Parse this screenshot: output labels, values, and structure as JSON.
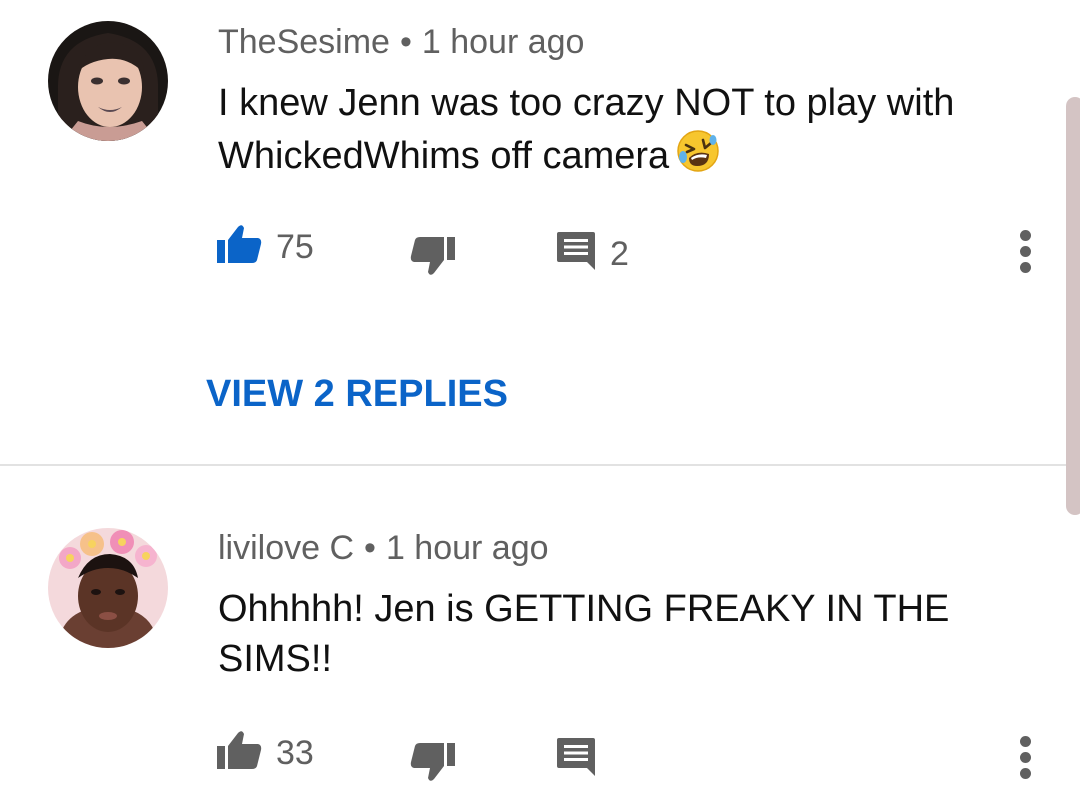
{
  "comments": [
    {
      "author": "TheSesime",
      "separator": "•",
      "time": "1 hour ago",
      "text": "I knew Jenn was too crazy NOT to play with WhickedWhims off camera",
      "emoji": "rolling-on-floor-laughing",
      "likes": "75",
      "replies_count": "2",
      "view_replies_label": "VIEW 2 REPLIES",
      "like_color": "#0b64c8"
    },
    {
      "author": "livilove C",
      "separator": "•",
      "time": "1 hour ago",
      "text": "Ohhhhh! Jen is GETTING FREAKY IN THE SIMS!!",
      "likes": "33",
      "like_color": "#606060"
    }
  ],
  "colors": {
    "link": "#0b64c8",
    "meta": "#606060",
    "text": "#111111",
    "divider": "#e2e2e2",
    "scrollbar": "#d4c4c4"
  }
}
